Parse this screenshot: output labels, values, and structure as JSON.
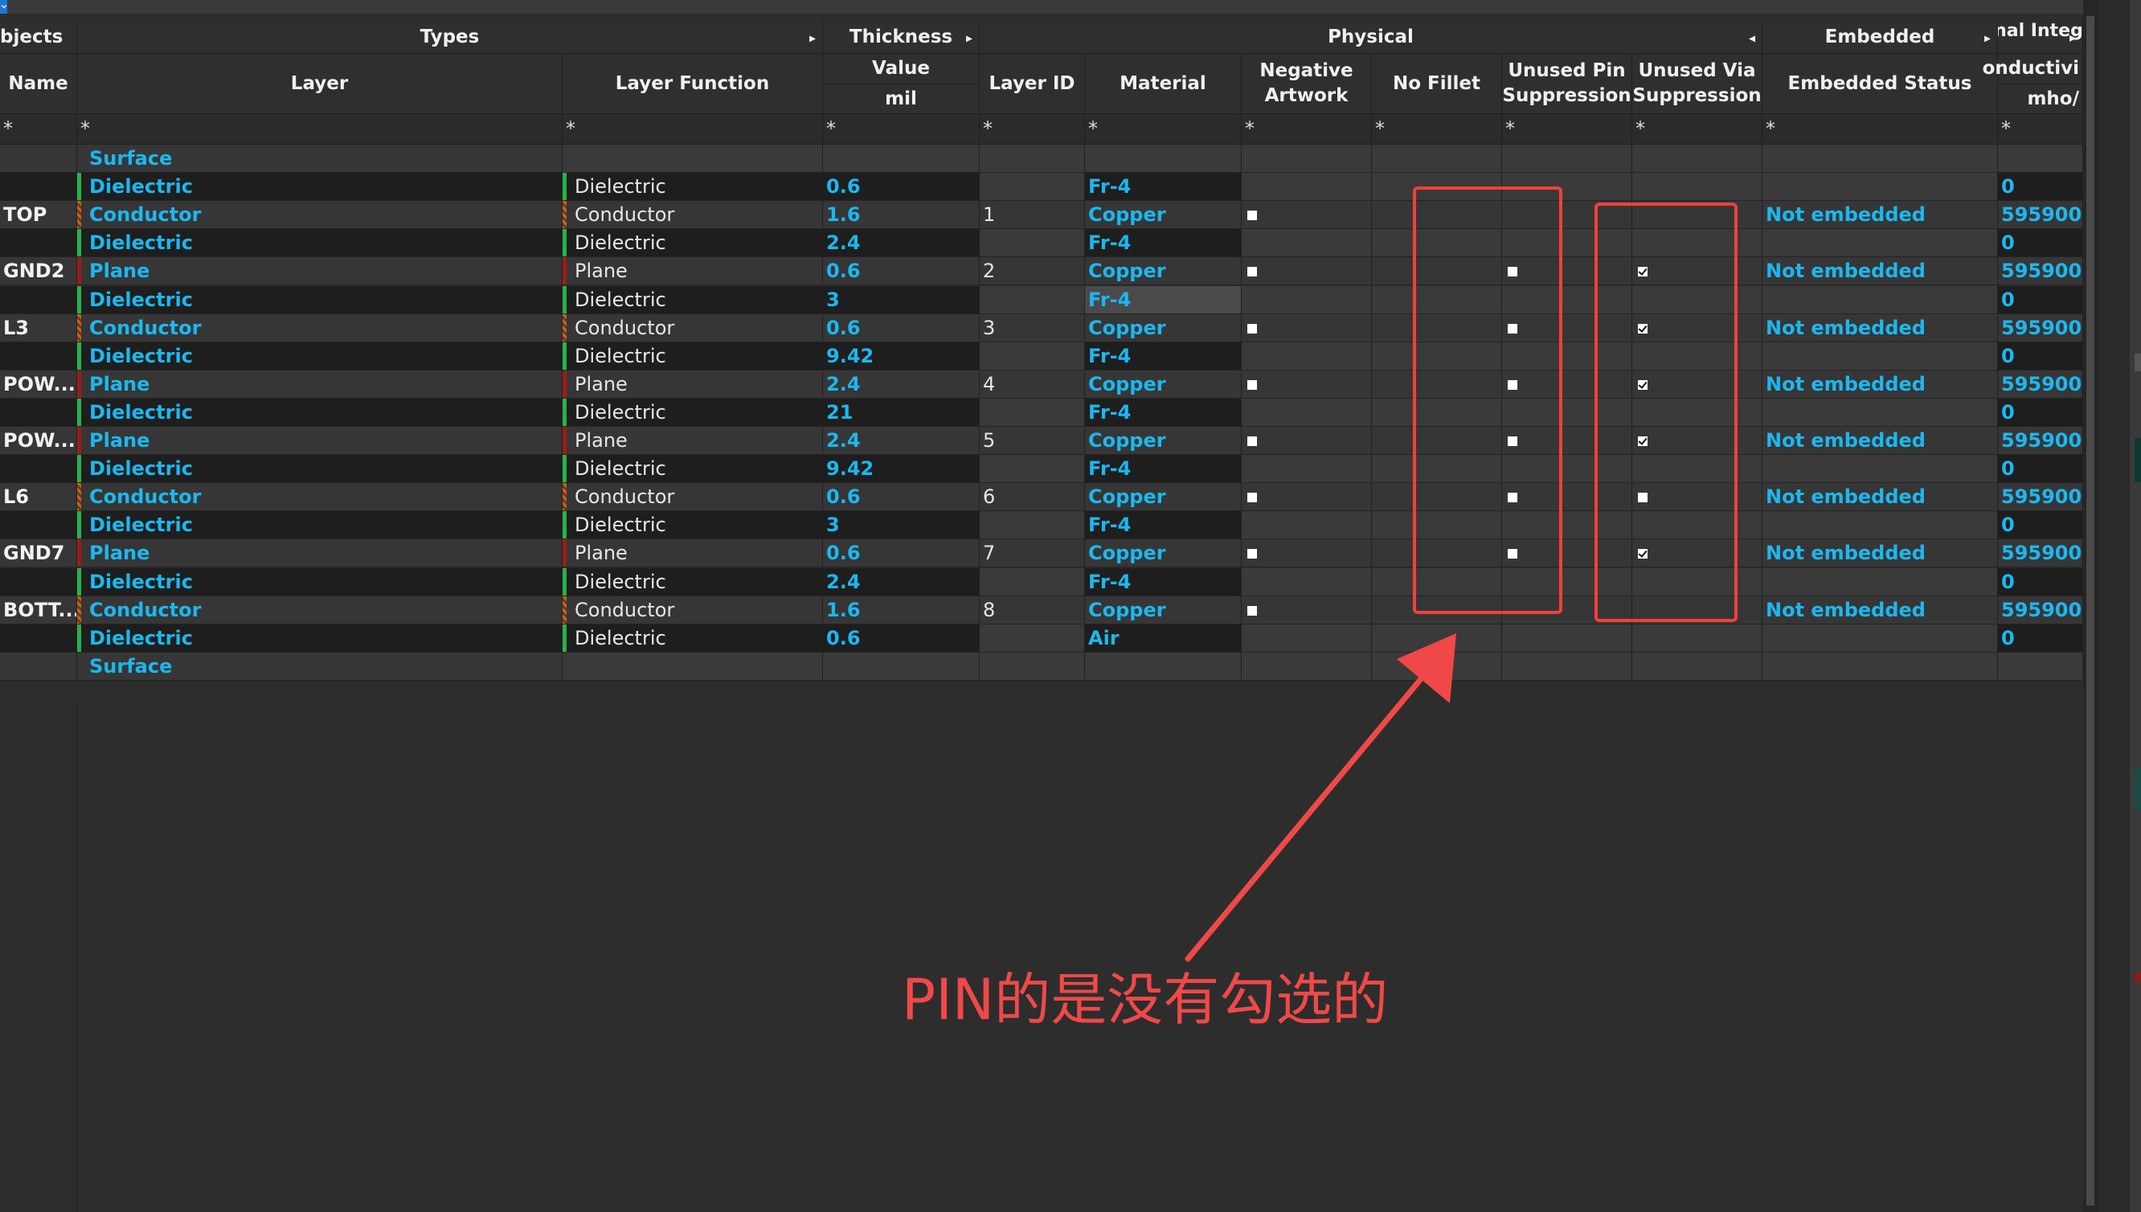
{
  "header_groups": [
    {
      "label": "bjects",
      "arrow": ""
    },
    {
      "label": "Types",
      "arrow": "▸"
    },
    {
      "label": "Thickness",
      "arrow": "▸"
    },
    {
      "label": "Physical",
      "arrow": "◂"
    },
    {
      "label": "Embedded",
      "arrow": "▸"
    },
    {
      "label": "Signal Integrity",
      "arrow": "▸"
    }
  ],
  "columns": [
    {
      "label": "Name"
    },
    {
      "label": "Layer"
    },
    {
      "label": "Layer Function"
    },
    {
      "label": "Value",
      "unit": "mil"
    },
    {
      "label": "Layer ID"
    },
    {
      "label": "Material"
    },
    {
      "label": "Negative Artwork"
    },
    {
      "label": "No Fillet"
    },
    {
      "label": "Unused Pin Suppression"
    },
    {
      "label": "Unused Via Suppression"
    },
    {
      "label": "Embedded Status"
    },
    {
      "label": "onductivi",
      "unit": "mho/"
    }
  ],
  "filter_symbol": "*",
  "rows": [
    {
      "name": "",
      "layer": "Surface",
      "type": "surface",
      "function": "",
      "thickness": "",
      "id": "",
      "material": "",
      "negative": null,
      "unused_pin": null,
      "unused_via": null,
      "embedded": "",
      "conductivity": ""
    },
    {
      "name": "",
      "layer": "Dielectric",
      "type": "dielectric",
      "function": "Dielectric",
      "thickness": "0.6",
      "id": "",
      "material": "Fr-4",
      "negative": null,
      "unused_pin": null,
      "unused_via": null,
      "embedded": "",
      "conductivity": "0"
    },
    {
      "name": "TOP",
      "layer": "Conductor",
      "type": "conductor",
      "function": "Conductor",
      "thickness": "1.6",
      "id": "1",
      "material": "Copper",
      "negative": false,
      "unused_pin": null,
      "unused_via": null,
      "embedded": "Not embedded",
      "conductivity": "595900"
    },
    {
      "name": "",
      "layer": "Dielectric",
      "type": "dielectric",
      "function": "Dielectric",
      "thickness": "2.4",
      "id": "",
      "material": "Fr-4",
      "negative": null,
      "unused_pin": null,
      "unused_via": null,
      "embedded": "",
      "conductivity": "0"
    },
    {
      "name": "GND2",
      "layer": "Plane",
      "type": "plane",
      "function": "Plane",
      "thickness": "0.6",
      "id": "2",
      "material": "Copper",
      "negative": false,
      "unused_pin": false,
      "unused_via": true,
      "embedded": "Not embedded",
      "conductivity": "595900"
    },
    {
      "name": "",
      "layer": "Dielectric",
      "type": "dielectric",
      "function": "Dielectric",
      "thickness": "3",
      "id": "",
      "material": "Fr-4",
      "negative": null,
      "unused_pin": null,
      "unused_via": null,
      "embedded": "",
      "conductivity": "0",
      "material_selected": true
    },
    {
      "name": "L3",
      "layer": "Conductor",
      "type": "conductor",
      "function": "Conductor",
      "thickness": "0.6",
      "id": "3",
      "material": "Copper",
      "negative": false,
      "unused_pin": false,
      "unused_via": true,
      "embedded": "Not embedded",
      "conductivity": "595900"
    },
    {
      "name": "",
      "layer": "Dielectric",
      "type": "dielectric",
      "function": "Dielectric",
      "thickness": "9.42",
      "id": "",
      "material": "Fr-4",
      "negative": null,
      "unused_pin": null,
      "unused_via": null,
      "embedded": "",
      "conductivity": "0"
    },
    {
      "name": "POW...",
      "layer": "Plane",
      "type": "plane",
      "function": "Plane",
      "thickness": "2.4",
      "id": "4",
      "material": "Copper",
      "negative": false,
      "unused_pin": false,
      "unused_via": true,
      "embedded": "Not embedded",
      "conductivity": "595900"
    },
    {
      "name": "",
      "layer": "Dielectric",
      "type": "dielectric",
      "function": "Dielectric",
      "thickness": "21",
      "id": "",
      "material": "Fr-4",
      "negative": null,
      "unused_pin": null,
      "unused_via": null,
      "embedded": "",
      "conductivity": "0"
    },
    {
      "name": "POW...",
      "layer": "Plane",
      "type": "plane",
      "function": "Plane",
      "thickness": "2.4",
      "id": "5",
      "material": "Copper",
      "negative": false,
      "unused_pin": false,
      "unused_via": true,
      "embedded": "Not embedded",
      "conductivity": "595900"
    },
    {
      "name": "",
      "layer": "Dielectric",
      "type": "dielectric",
      "function": "Dielectric",
      "thickness": "9.42",
      "id": "",
      "material": "Fr-4",
      "negative": null,
      "unused_pin": null,
      "unused_via": null,
      "embedded": "",
      "conductivity": "0"
    },
    {
      "name": "L6",
      "layer": "Conductor",
      "type": "conductor",
      "function": "Conductor",
      "thickness": "0.6",
      "id": "6",
      "material": "Copper",
      "negative": false,
      "unused_pin": false,
      "unused_via": false,
      "embedded": "Not embedded",
      "conductivity": "595900"
    },
    {
      "name": "",
      "layer": "Dielectric",
      "type": "dielectric",
      "function": "Dielectric",
      "thickness": "3",
      "id": "",
      "material": "Fr-4",
      "negative": null,
      "unused_pin": null,
      "unused_via": null,
      "embedded": "",
      "conductivity": "0"
    },
    {
      "name": "GND7",
      "layer": "Plane",
      "type": "plane",
      "function": "Plane",
      "thickness": "0.6",
      "id": "7",
      "material": "Copper",
      "negative": false,
      "unused_pin": false,
      "unused_via": true,
      "embedded": "Not embedded",
      "conductivity": "595900"
    },
    {
      "name": "",
      "layer": "Dielectric",
      "type": "dielectric",
      "function": "Dielectric",
      "thickness": "2.4",
      "id": "",
      "material": "Fr-4",
      "negative": null,
      "unused_pin": null,
      "unused_via": null,
      "embedded": "",
      "conductivity": "0"
    },
    {
      "name": "BOTT...",
      "layer": "Conductor",
      "type": "conductor",
      "function": "Conductor",
      "thickness": "1.6",
      "id": "8",
      "material": "Copper",
      "negative": false,
      "unused_pin": null,
      "unused_via": null,
      "embedded": "Not embedded",
      "conductivity": "595900"
    },
    {
      "name": "",
      "layer": "Dielectric",
      "type": "dielectric",
      "function": "Dielectric",
      "thickness": "0.6",
      "id": "",
      "material": "Air",
      "negative": null,
      "unused_pin": null,
      "unused_via": null,
      "embedded": "",
      "conductivity": "0"
    },
    {
      "name": "",
      "layer": "Surface",
      "type": "surface",
      "function": "",
      "thickness": "",
      "id": "",
      "material": "",
      "negative": null,
      "unused_pin": null,
      "unused_via": null,
      "embedded": "",
      "conductivity": ""
    }
  ],
  "annotation": {
    "text": "PIN的是没有勾选的",
    "color": "#f04848"
  },
  "colors": {
    "cyan_text": "#1bb8f0",
    "dielectric_bar": "#27b34a",
    "conductor_bar": "#c8641e",
    "plane_bar": "#9b1c1c",
    "highlight": "#f04040"
  }
}
